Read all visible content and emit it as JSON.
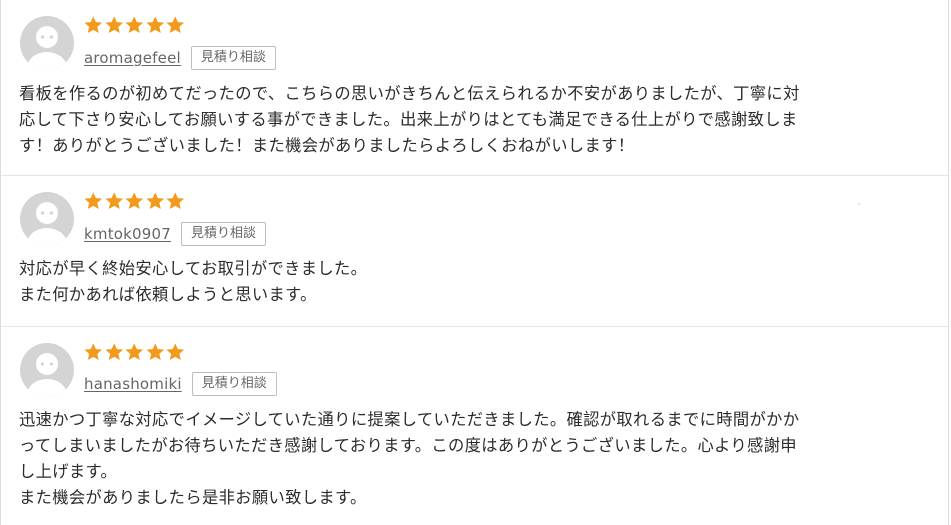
{
  "colors": {
    "star": "#f29a1c",
    "avatar_bg": "#d4d4d4",
    "avatar_fg": "#ffffff",
    "text": "#2b2b2b",
    "username": "#666666"
  },
  "reviews": [
    {
      "username": "aromagefeel",
      "badge": "見積り相談",
      "rating": 5,
      "comment": "看板を作るのが初めてだったので、こちらの思いがきちんと伝えられるか不安がありましたが、丁寧に対\n応して下さり安心してお願いする事ができました。出来上がりはとても満足できる仕上がりで感謝致しま\nす！ありがとうございました！また機会がありましたらよろしくおねがいします！"
    },
    {
      "username": "kmtok0907",
      "badge": "見積り相談",
      "rating": 5,
      "comment": "対応が早く終始安心してお取引ができました。\nまた何かあれば依頼しようと思います。"
    },
    {
      "username": "hanashomiki",
      "badge": "見積り相談",
      "rating": 5,
      "comment": "迅速かつ丁寧な対応でイメージしていた通りに提案していただきました。確認が取れるまでに時間がかか\nってしまいましたがお待ちいただき感謝しております。この度はありがとうございました。心より感謝申\nし上げます。\nまた機会がありましたら是非お願い致します。"
    }
  ]
}
